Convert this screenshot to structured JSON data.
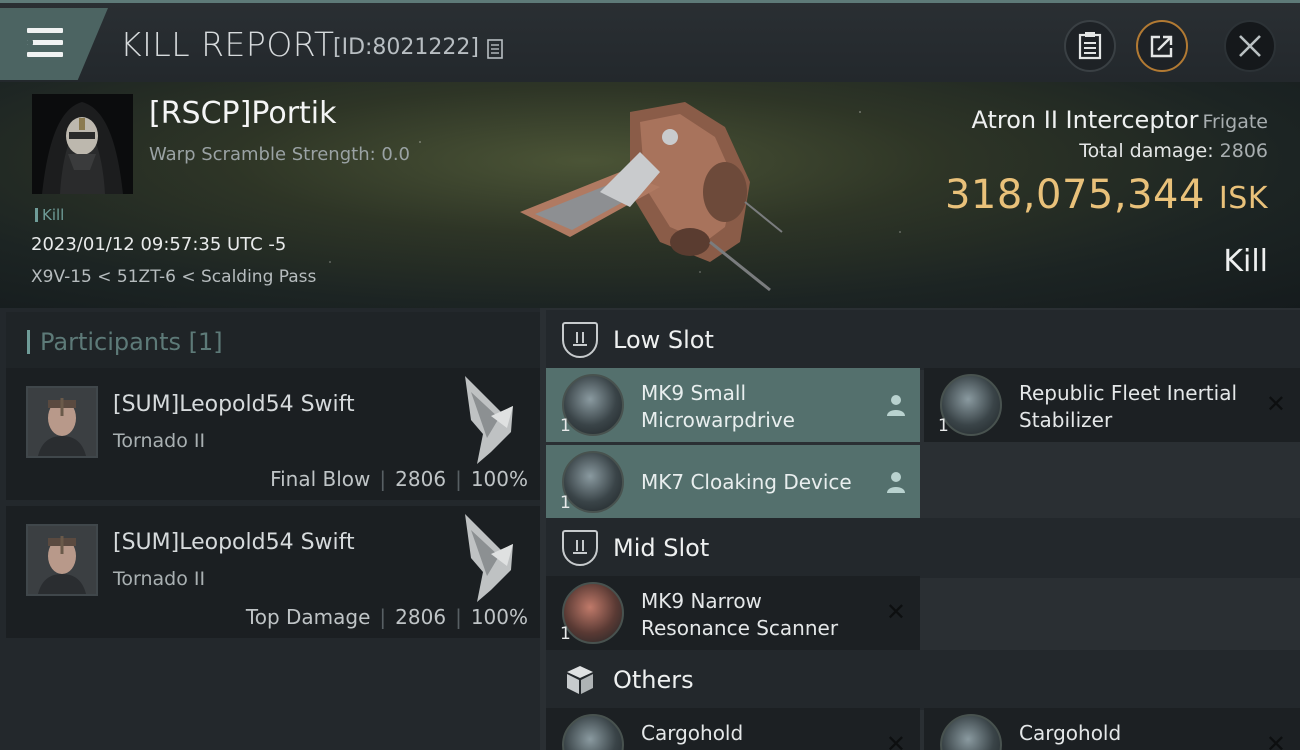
{
  "header": {
    "title": "KILL REPORT",
    "report_id": "[ID:8021222]",
    "icons": [
      "menu-icon",
      "copy-icon",
      "clipboard-icon",
      "share-icon",
      "close-icon"
    ]
  },
  "victim": {
    "name": "[RSCP]Portik",
    "warp_scramble": "Warp Scramble Strength: 0.0",
    "tag": "Kill",
    "datetime": "2023/01/12 09:57:35 UTC -5",
    "location": "X9V-15 < 51ZT-6 < Scalding Pass"
  },
  "ship": {
    "name": "Atron II Interceptor",
    "class": "Frigate",
    "total_damage_label": "Total damage:",
    "total_damage": "2806",
    "isk_value": "318,075,344",
    "isk_unit": "ISK",
    "result": "Kill"
  },
  "participants": {
    "heading": "Participants [1]",
    "items": [
      {
        "name": "[SUM]Leopold54 Swift",
        "ship": "Tornado II",
        "role": "Final Blow",
        "damage": "2806",
        "percent": "100%"
      },
      {
        "name": "[SUM]Leopold54 Swift",
        "ship": "Tornado II",
        "role": "Top Damage",
        "damage": "2806",
        "percent": "100%"
      }
    ]
  },
  "fitting": {
    "low_slot": {
      "label": "Low Slot",
      "modules": [
        {
          "name": "MK9 Small\nMicrowarpdrive",
          "qty": "1"
        },
        {
          "name": "Republic Fleet Inertial\nStabilizer",
          "qty": "1"
        },
        {
          "name": "MK7 Cloaking Device",
          "qty": "1"
        }
      ]
    },
    "mid_slot": {
      "label": "Mid Slot",
      "modules": [
        {
          "name": "MK9 Narrow\nResonance Scanner",
          "qty": "1"
        }
      ]
    },
    "others": {
      "label": "Others",
      "modules": [
        {
          "name": "Cargohold"
        },
        {
          "name": "Cargohold"
        }
      ]
    }
  },
  "colors": {
    "accent": "#6f9c98",
    "isk": "#e9c17a",
    "active_module": "#54706d"
  }
}
